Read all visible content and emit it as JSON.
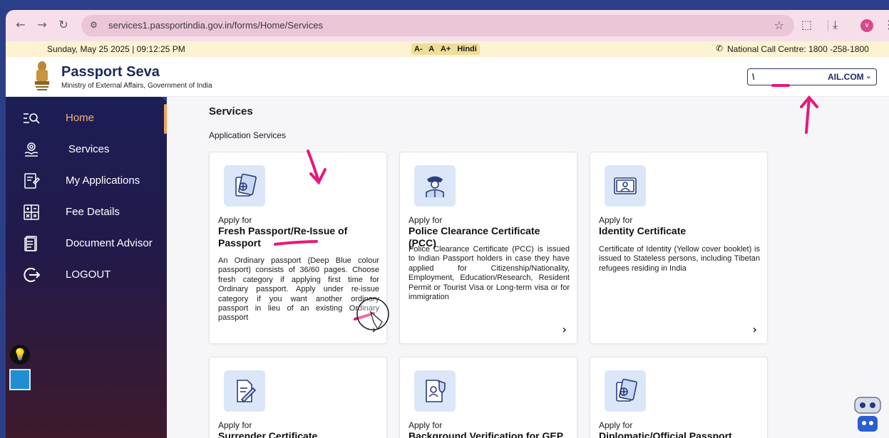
{
  "browser": {
    "url": "services1.passportindia.gov.in/forms/Home/Services",
    "profile_initial": "v"
  },
  "infobar": {
    "datetime": "Sunday, May 25 2025 | 09:12:25 PM",
    "font_small": "A-",
    "font_normal": "A",
    "font_large": "A+",
    "language": "Hindi",
    "call_centre": "National Call Centre: 1800 -258-1800"
  },
  "header": {
    "title": "Passport Seva",
    "subtitle": "Ministry of External Affairs, Government of India",
    "user_prefix": "\\",
    "user_suffix": "AIL.COM"
  },
  "sidebar": {
    "items": [
      {
        "label": "Home",
        "icon": "home-search-icon"
      },
      {
        "label": "Services",
        "icon": "services-icon"
      },
      {
        "label": "My Applications",
        "icon": "applications-icon"
      },
      {
        "label": "Fee Details",
        "icon": "calculator-icon"
      },
      {
        "label": "Document Advisor",
        "icon": "document-icon"
      },
      {
        "label": "LOGOUT",
        "icon": "logout-icon"
      }
    ]
  },
  "main": {
    "title": "Services",
    "section": "Application Services",
    "cards": [
      {
        "apply": "Apply for",
        "title": "Fresh Passport/Re-Issue of Passport",
        "desc": "An Ordinary passport (Deep Blue colour passport) consists of 36/60 pages. Choose fresh category if applying first time for Ordinary passport. Apply under re-issue category if you want another ordinary passport in lieu of an existing Ordinary passport",
        "icon": "passport-icon"
      },
      {
        "apply": "Apply for",
        "title": "Police Clearance Certificate (PCC)",
        "desc": "Police Clearance Certificate (PCC) is issued to Indian Passport holders in case they have applied for Citizenship/Nationality, Employment, Education/Research, Resident Permit or Tourist Visa or Long-term visa or for immigration",
        "icon": "police-icon"
      },
      {
        "apply": "Apply for",
        "title": "Identity Certificate",
        "desc": "Certificate of Identity (Yellow cover booklet) is issued to Stateless persons, including Tibetan refugees residing in India",
        "icon": "id-card-icon"
      },
      {
        "apply": "Apply for",
        "title": "Surrender Certificate",
        "icon": "surrender-icon"
      },
      {
        "apply": "Apply for",
        "title": "Background Verification for GEP",
        "icon": "verification-icon"
      },
      {
        "apply": "Apply for",
        "title": "Diplomatic/Official Passport",
        "icon": "diplomatic-passport-icon"
      }
    ]
  },
  "colors": {
    "sidebar_top": "#1c1e56",
    "sidebar_bottom": "#3e1a2c",
    "active_accent": "#f2a25b",
    "brand_navy": "#1b2a5c",
    "icon_tile": "#dbe6f8"
  }
}
